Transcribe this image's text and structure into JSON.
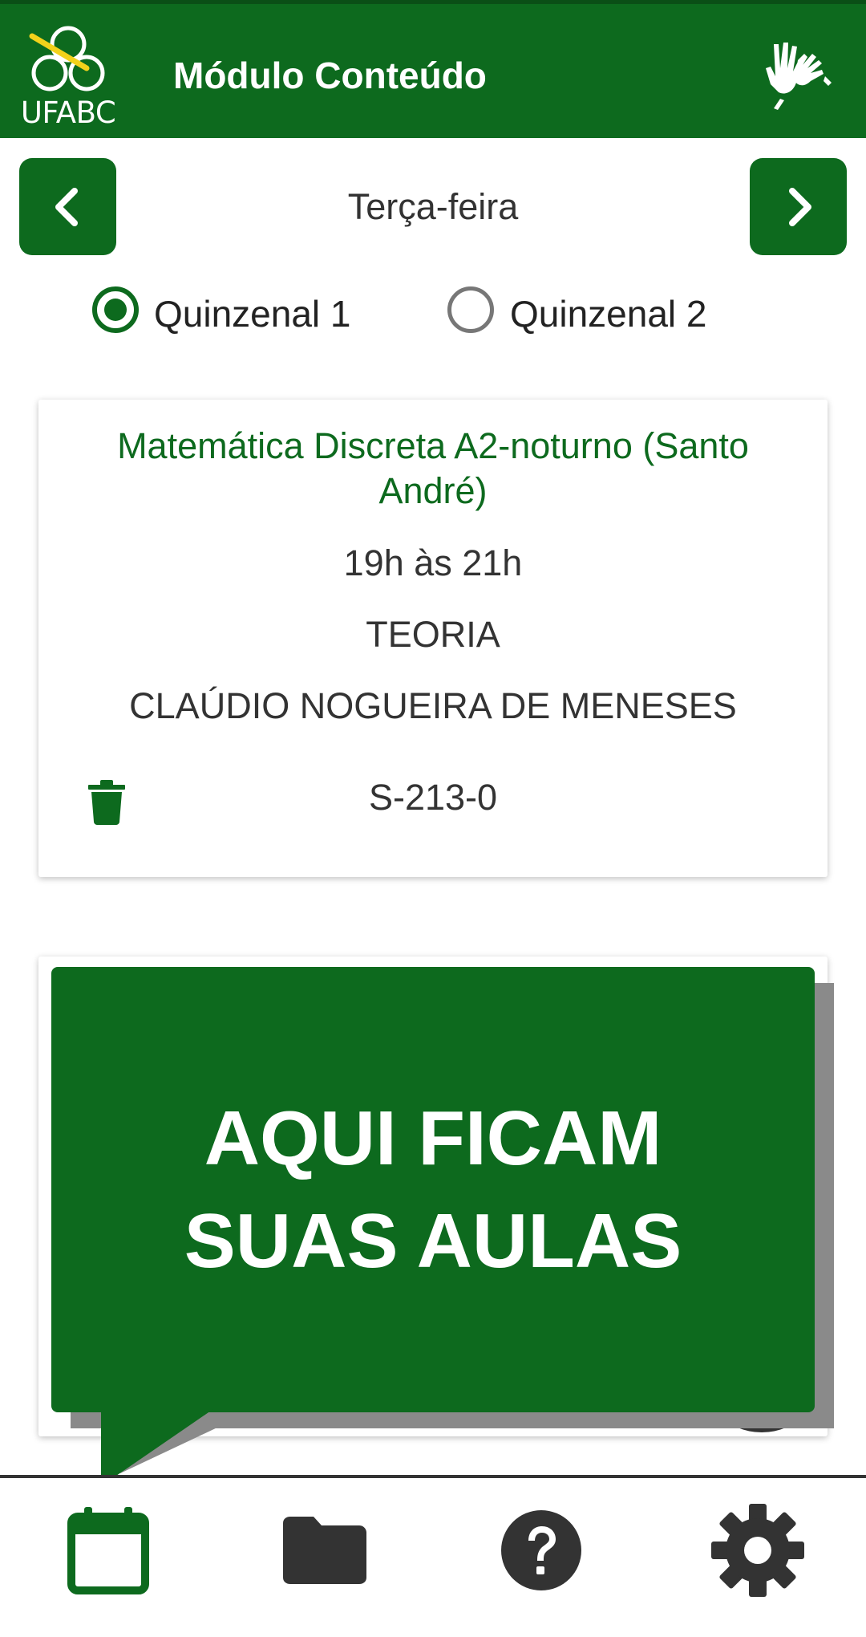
{
  "header": {
    "logo_text": "UFABC",
    "title": "Módulo Conteúdo",
    "libras_icon": "sign-language-hands-icon"
  },
  "day_nav": {
    "prev_icon": "chevron-left-icon",
    "next_icon": "chevron-right-icon",
    "day": "Terça-feira"
  },
  "biweekly": {
    "options": [
      {
        "label": "Quinzenal 1",
        "selected": true
      },
      {
        "label": "Quinzenal 2",
        "selected": false
      }
    ]
  },
  "class_card": {
    "course": "Matemática Discreta A2-noturno (Santo André)",
    "time": "19h às 21h",
    "type": "TEORIA",
    "teacher": "CLAÚDIO NOGUEIRA DE MENESES",
    "room": "S-213-0",
    "delete_icon": "trash-icon"
  },
  "tooltip": {
    "text": "AQUI FICAM\nSUAS AULAS"
  },
  "bottom_nav": {
    "items": [
      {
        "icon": "calendar-icon",
        "active": true
      },
      {
        "icon": "folder-icon",
        "active": false
      },
      {
        "icon": "help-icon",
        "active": false
      },
      {
        "icon": "gear-icon",
        "active": false
      }
    ]
  },
  "colors": {
    "primary": "#0d6a1e",
    "dark": "#333333"
  }
}
